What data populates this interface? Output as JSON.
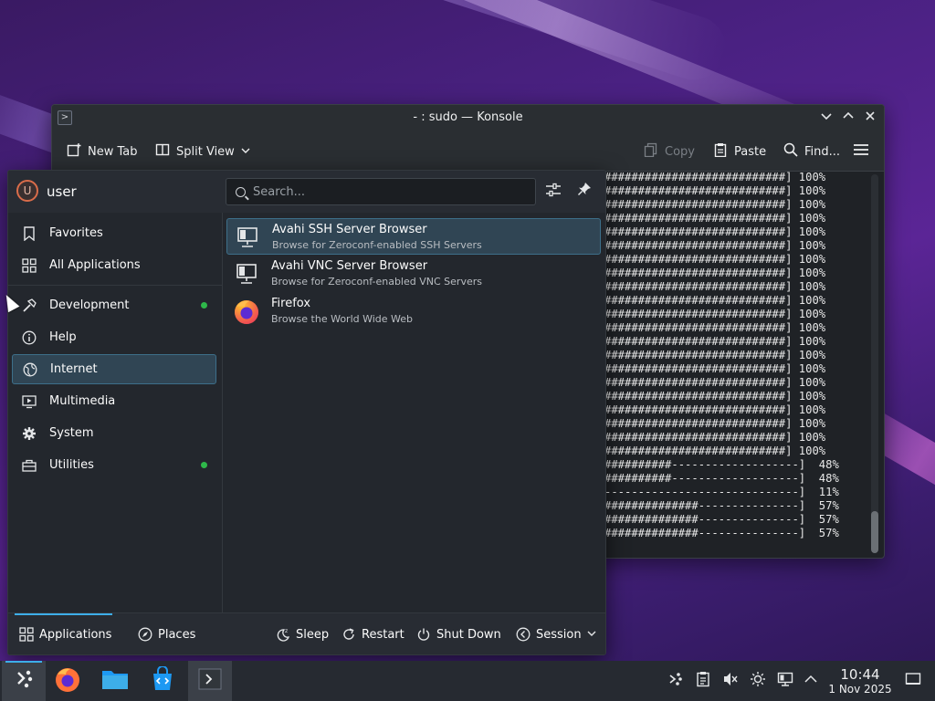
{
  "konsole": {
    "title": "- : sudo — Konsole",
    "toolbar": {
      "new_tab": "New Tab",
      "split_view": "Split View",
      "copy": "Copy",
      "paste": "Paste",
      "find": "Find..."
    },
    "terminal_lines": [
      "###########################] 100%",
      "###########################] 100%",
      "###########################] 100%",
      "###########################] 100%",
      "###########################] 100%",
      "###########################] 100%",
      "###########################] 100%",
      "###########################] 100%",
      "###########################] 100%",
      "###########################] 100%",
      "###########################] 100%",
      "###########################] 100%",
      "###########################] 100%",
      "###########################] 100%",
      "###########################] 100%",
      "###########################] 100%",
      "###########################] 100%",
      "###########################] 100%",
      "###########################] 100%",
      "###########################] 100%",
      "###########################] 100%",
      "##########-------------------]  48%",
      "##########-------------------]  48%",
      "-----------------------------]  11%",
      "##############---------------]  57%",
      "##############---------------]  57%",
      "##############---------------]  57%"
    ]
  },
  "launcher": {
    "user": {
      "avatar_letter": "U",
      "name": "user"
    },
    "search": {
      "placeholder": "Search..."
    },
    "categories": [
      {
        "label": "Favorites",
        "icon": "bookmark-icon"
      },
      {
        "label": "All Applications",
        "icon": "grid-icon"
      },
      {
        "label": "Development",
        "icon": "hammer-icon",
        "new": true
      },
      {
        "label": "Help",
        "icon": "help-icon"
      },
      {
        "label": "Internet",
        "icon": "globe-icon",
        "active": true
      },
      {
        "label": "Multimedia",
        "icon": "multimedia-icon"
      },
      {
        "label": "System",
        "icon": "gear-icon"
      },
      {
        "label": "Utilities",
        "icon": "toolbox-icon",
        "new": true
      }
    ],
    "apps": [
      {
        "name": "Avahi SSH Server Browser",
        "description": "Browse for Zeroconf-enabled SSH Servers",
        "icon": "network-computer-icon",
        "active": true
      },
      {
        "name": "Avahi VNC Server Browser",
        "description": "Browse for Zeroconf-enabled VNC Servers",
        "icon": "network-computer-icon"
      },
      {
        "name": "Firefox",
        "description": "Browse the World Wide Web",
        "icon": "firefox-icon"
      }
    ],
    "footer": {
      "applications": "Applications",
      "places": "Places",
      "sleep": "Sleep",
      "restart": "Restart",
      "shut_down": "Shut Down",
      "session": "Session"
    }
  },
  "taskbar": {
    "clock": {
      "time": "10:44",
      "date": "1 Nov 2025"
    }
  },
  "colors": {
    "accent": "#3daee9",
    "new_dot": "#2eb84a"
  }
}
